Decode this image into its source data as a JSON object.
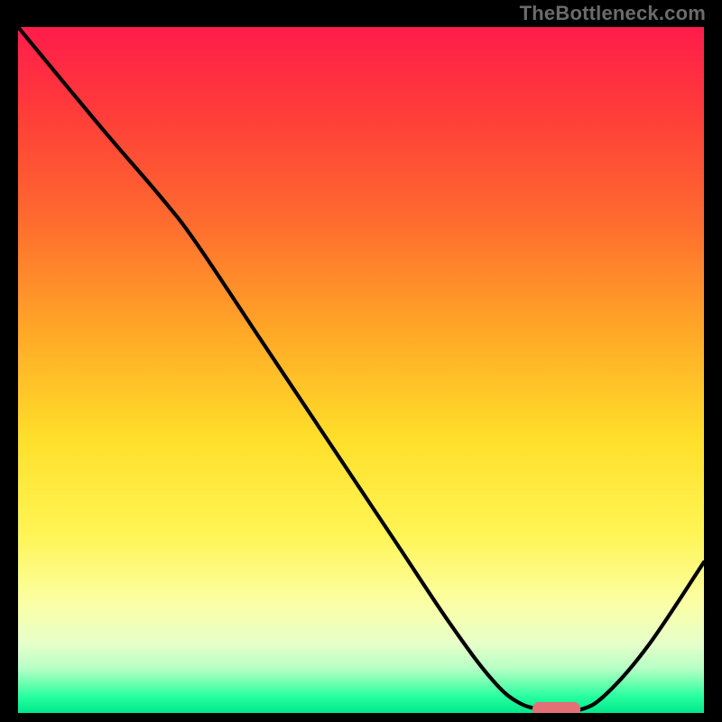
{
  "attribution": "TheBottleneck.com",
  "chart_data": {
    "type": "line",
    "title": "",
    "xlabel": "",
    "ylabel": "",
    "xlim": [
      0,
      100
    ],
    "ylim": [
      0,
      100
    ],
    "background_gradient": {
      "stops": [
        {
          "offset": 0.0,
          "color": "#ff1c4b"
        },
        {
          "offset": 0.12,
          "color": "#ff3b3a"
        },
        {
          "offset": 0.28,
          "color": "#ff6a2f"
        },
        {
          "offset": 0.45,
          "color": "#ffaa26"
        },
        {
          "offset": 0.6,
          "color": "#ffdf2a"
        },
        {
          "offset": 0.74,
          "color": "#fff555"
        },
        {
          "offset": 0.84,
          "color": "#fbffa5"
        },
        {
          "offset": 0.9,
          "color": "#e6ffca"
        },
        {
          "offset": 0.935,
          "color": "#b6ffc5"
        },
        {
          "offset": 0.955,
          "color": "#73ffb0"
        },
        {
          "offset": 0.975,
          "color": "#2affa0"
        },
        {
          "offset": 1.0,
          "color": "#00e88d"
        }
      ]
    },
    "series": [
      {
        "name": "bottleneck-curve",
        "stroke": "#000000",
        "points": [
          {
            "x": 0.0,
            "y": 100.0
          },
          {
            "x": 12.0,
            "y": 85.5
          },
          {
            "x": 21.0,
            "y": 75.0
          },
          {
            "x": 26.0,
            "y": 68.5
          },
          {
            "x": 35.0,
            "y": 55.0
          },
          {
            "x": 45.0,
            "y": 40.0
          },
          {
            "x": 55.0,
            "y": 25.0
          },
          {
            "x": 63.0,
            "y": 13.0
          },
          {
            "x": 69.0,
            "y": 5.0
          },
          {
            "x": 73.0,
            "y": 1.5
          },
          {
            "x": 77.0,
            "y": 0.5
          },
          {
            "x": 82.0,
            "y": 0.5
          },
          {
            "x": 86.0,
            "y": 3.0
          },
          {
            "x": 92.0,
            "y": 10.0
          },
          {
            "x": 100.0,
            "y": 22.0
          }
        ]
      }
    ],
    "marker": {
      "name": "optimal-range",
      "x_start": 75.0,
      "x_end": 82.0,
      "y": 0.5,
      "fill": "#e46f76",
      "thickness": 2.2
    }
  }
}
